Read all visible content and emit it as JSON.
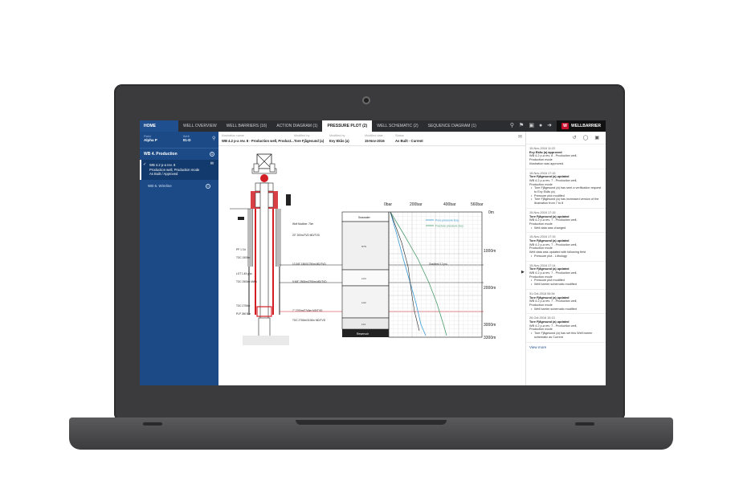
{
  "nav": {
    "home": "HOME",
    "tabs": [
      {
        "label": "WELL OVERVIEW",
        "active": false
      },
      {
        "label": "WELL BARRIERS (16)",
        "active": false
      },
      {
        "label": "ACTION DIAGRAM (1)",
        "active": false
      },
      {
        "label": "PRESSURE PLOT (2)",
        "active": true
      },
      {
        "label": "WELL SCHEMATIC (2)",
        "active": false
      },
      {
        "label": "SEQUENCE DIAGRAM (1)",
        "active": false
      }
    ],
    "brand": "WELLBARRIER"
  },
  "sidebar": {
    "field_label": "Field",
    "field_value": "Alpha P",
    "well_label": "Well",
    "well_value": "01-D",
    "section_title": "WB 4. Production",
    "section_count": "1",
    "active_item_lines": [
      "WB 4.2 p-a rev. 8",
      "Production well, Production mode",
      "As Built / Approved"
    ],
    "item2_label": "WB 6. Wireline",
    "item2_count": "1"
  },
  "info": {
    "cols": [
      {
        "label": "Illustration name",
        "value": "WB 4.2 p-a rev. 8 - Production well, Product..."
      },
      {
        "label": "Modified by",
        "value": "Tore Fjågesund (a)"
      },
      {
        "label": "Modified by",
        "value": "Evy Ekås (a)"
      },
      {
        "label": "Modified date",
        "value": "15-Nov-2016"
      },
      {
        "label": "Status",
        "value": "As Built - Current"
      }
    ]
  },
  "plot": {
    "top_ticks": [
      "0bar",
      "200bar",
      "400bar",
      "560bar"
    ],
    "right_ticks": [
      "0m",
      "1000m",
      "2000m",
      "3000m",
      "3300m"
    ],
    "legend": [
      "Pore pressure Exp.",
      "Fracture pressure Exp."
    ],
    "seawater_label": "Seawater",
    "reservoir_label": "Reservoir",
    "gradient_label": "Gradient 0.2 psi",
    "strata": [
      "NTS",
      "LO4",
      "LO2",
      "LK1"
    ],
    "annotations": [
      "Well Mudline: 70m",
      "20\" 200m/TVD  MD/TVD",
      "13 3/8\" 1800/1750m MD/TVD",
      "9 5/8\" 2500m/2750m MD/TVD",
      "7\" 2700m/2740m MD/TVD",
      "PP 1 3 b",
      "TOC 1500m",
      "LOT 1.45 g/cc",
      "TOC 2500m MWh",
      "TOC 2750m",
      "PLP 260 Bar",
      "TOC 2750m/3100m MD/TVD"
    ]
  },
  "history": {
    "entries": [
      {
        "date": "15-Nov-2016 11:22",
        "name": "Evy Ekås (a) approved",
        "lines": [
          "WB 4.2 p-a rev. 8 - Production well,",
          "Production mode",
          "Illustration was approved."
        ],
        "bullets": []
      },
      {
        "date": "15-Nov-2016 17:15",
        "name": "Tore Fjågesund (a) updated",
        "lines": [
          "WB 4.2 p-a rev. 7 - Production well,",
          "Production mode"
        ],
        "bullets": [
          "Tore Fjågesund (a) has sent a verification request to Evy Ekås (a)",
          "Pressure plot modified",
          "Tore Fjågesund (a) has increased version of the illustration from 7 to 8"
        ]
      },
      {
        "date": "15-Nov-2016 17:15",
        "name": "Tore Fjågesund (a) updated",
        "lines": [
          "WB 4.2 p-a rev. 7 - Production well,",
          "Production mode"
        ],
        "bullets": [
          "Well data was changed"
        ]
      },
      {
        "date": "15-Nov-2016 17:15",
        "name": "Tore Fjågesund (a) updated",
        "lines": [
          "WB 4.2 p-a rev. 7 - Production well,",
          "Production mode",
          "Well data was updated with following field"
        ],
        "bullets": [
          "Pressure plot - Lithology"
        ]
      },
      {
        "date": "15-Nov-2016 17:14",
        "name": "Tore Fjågesund (a) updated",
        "lines": [
          "WB 4.2 p-a rev. 7 - Production well,",
          "Production mode"
        ],
        "bullets": [
          "Pressure plot modified",
          "Well barrier schematic modified"
        ]
      },
      {
        "date": "31-Oct-2016 06:54",
        "name": "Tore Fjågesund (a) updated",
        "lines": [
          "WB 4.2 p-a rev. 7 - Production well,",
          "Production mode"
        ],
        "bullets": [
          "Well barrier schematic modified"
        ]
      },
      {
        "date": "26-Oct-2016 15:13",
        "name": "Tore Fjågesund (a) updated",
        "lines": [
          "WB 4.2 p-a rev. 7 - Production well,",
          "Production mode"
        ],
        "bullets": [
          "Tore Fjågesund (a) has set this Well barrier schematic as Current"
        ]
      }
    ],
    "more": "View more"
  },
  "colors": {
    "brand_blue": "#1f4f8e",
    "barrier_red": "#d21f26",
    "pore_line": "#3a9bd5",
    "frac_line": "#4a9c6e"
  }
}
